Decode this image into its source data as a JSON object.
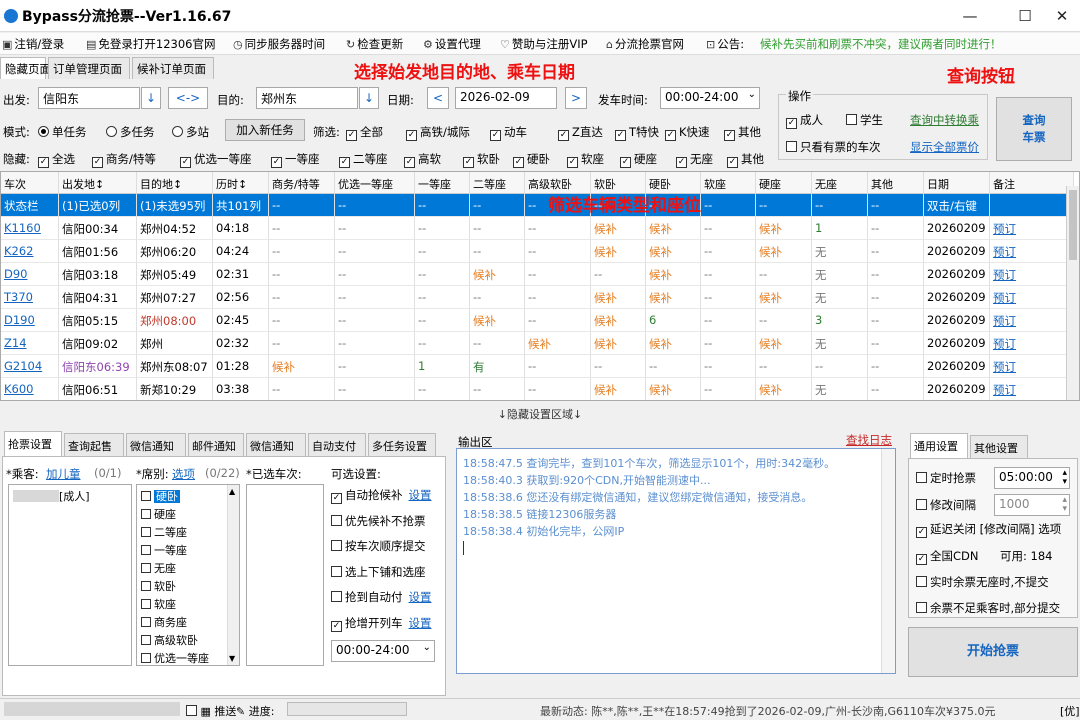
{
  "window": {
    "title": "Bypass分流抢票--Ver1.16.67",
    "min": "—",
    "max": "☐",
    "close": "✕"
  },
  "menu": [
    {
      "icon": "▣",
      "label": "注销/登录"
    },
    {
      "icon": "▤",
      "label": "免登录打开12306官网"
    },
    {
      "icon": "◷",
      "label": "同步服务器时间"
    },
    {
      "icon": "↻",
      "label": "检查更新"
    },
    {
      "icon": "⚙",
      "label": "设置代理"
    },
    {
      "icon": "♡",
      "label": "赞助与注册VIP"
    },
    {
      "icon": "⌂",
      "label": "分流抢票官网"
    },
    {
      "icon": "⊡",
      "label": "公告:"
    }
  ],
  "notice": "候补先买前和刷票不冲突，建议两者同时进行！",
  "tabs": [
    "隐藏页面",
    "订单管理页面",
    "候补订单页面"
  ],
  "annotations": {
    "top": "选择始发地目的地、乘车日期",
    "query": "查询按钮",
    "grid": "筛选车辆类型和座位"
  },
  "search": {
    "from_label": "出发:",
    "from": "信阳东",
    "swap": "<->",
    "to_label": "目的:",
    "to": "郑州东",
    "date_label": "日期:",
    "date": "2026-02-09",
    "prev": "<",
    "next": ">",
    "time_label": "发车时间:",
    "time": "00:00-24:00"
  },
  "ops": {
    "title": "操作",
    "adult": "成人",
    "student": "学生",
    "transfer": "查询中转换乘",
    "only_ticket": "只看有票的车次",
    "all_price": "显示全部票价",
    "query": "查询\n车票"
  },
  "mode": {
    "label": "模式:",
    "single": "单任务",
    "multi": "多任务",
    "multi_station": "多站",
    "add_task": "加入新任务",
    "filter_label": "筛选:",
    "filters": [
      "全部",
      "高铁/城际",
      "动车",
      "Z直达",
      "T特快",
      "K快速",
      "其他"
    ]
  },
  "hide": {
    "label": "隐藏:",
    "items": [
      "全选",
      "商务/特等",
      "优选一等座",
      "一等座",
      "二等座",
      "高软",
      "软卧",
      "硬卧",
      "软座",
      "硬座",
      "无座",
      "其他"
    ]
  },
  "grid": {
    "headers": [
      "车次",
      "出发地↕",
      "目的地↕",
      "历时↕",
      "商务/特等",
      "优选一等座",
      "一等座",
      "二等座",
      "高级软卧",
      "软卧",
      "硬卧",
      "软座",
      "硬座",
      "无座",
      "其他",
      "日期",
      "备注"
    ],
    "rows": [
      [
        "状态栏",
        "(1)已选0列",
        "(1)未选95列",
        "共101列",
        "--",
        "--",
        "--",
        "--",
        "--",
        "--",
        "--",
        "--",
        "--",
        "--",
        "--",
        "双击/右键",
        ""
      ],
      [
        "K1160",
        "信阳00:34",
        "郑州04:52",
        "04:18",
        "--",
        "--",
        "--",
        "--",
        "--",
        "候补",
        "候补",
        "--",
        "候补",
        "1",
        "--",
        "20260209",
        "预订"
      ],
      [
        "K262",
        "信阳01:56",
        "郑州06:20",
        "04:24",
        "--",
        "--",
        "--",
        "--",
        "--",
        "候补",
        "候补",
        "--",
        "候补",
        "无",
        "--",
        "20260209",
        "预订"
      ],
      [
        "D90",
        "信阳03:18",
        "郑州05:49",
        "02:31",
        "--",
        "--",
        "--",
        "候补",
        "--",
        "--",
        "候补",
        "--",
        "--",
        "无",
        "--",
        "20260209",
        "预订"
      ],
      [
        "T370",
        "信阳04:31",
        "郑州07:27",
        "02:56",
        "--",
        "--",
        "--",
        "--",
        "--",
        "候补",
        "候补",
        "--",
        "候补",
        "无",
        "--",
        "20260209",
        "预订"
      ],
      [
        "D190",
        "信阳05:15",
        "郑州08:00",
        "02:45",
        "--",
        "--",
        "--",
        "候补",
        "--",
        "候补",
        "6",
        "--",
        "--",
        "3",
        "--",
        "20260209",
        "预订"
      ],
      [
        "Z14",
        "信阳09:02",
        "郑州",
        "02:32",
        "--",
        "--",
        "--",
        "--",
        "候补",
        "候补",
        "候补",
        "--",
        "候补",
        "无",
        "--",
        "20260209",
        "预订"
      ],
      [
        "G2104",
        "信阳东06:39",
        "郑州东08:07",
        "01:28",
        "候补",
        "--",
        "1",
        "有",
        "--",
        "--",
        "--",
        "--",
        "--",
        "--",
        "--",
        "20260209",
        "预订"
      ],
      [
        "K600",
        "信阳06:51",
        "新郑10:29",
        "03:38",
        "--",
        "--",
        "--",
        "--",
        "--",
        "候补",
        "候补",
        "--",
        "候补",
        "无",
        "--",
        "20260209",
        "预订"
      ]
    ]
  },
  "hidden_area": "↓隐藏设置区域↓",
  "bottom_tabs": [
    "抢票设置",
    "查询起售",
    "微信通知",
    "邮件通知",
    "微信通知",
    "自动支付",
    "多任务设置"
  ],
  "passenger": {
    "label": "*乘客:",
    "add": "加儿童",
    "count": "(0/1)",
    "item": "[成人]"
  },
  "seats": {
    "label": "*席别:",
    "select": "选项",
    "count": "(0/22)",
    "items": [
      "硬卧",
      "硬座",
      "二等座",
      "一等座",
      "无座",
      "软卧",
      "软座",
      "商务座",
      "高级软卧",
      "优选一等座"
    ]
  },
  "selected_trains": {
    "label": "*已选车次:"
  },
  "options": {
    "title": "可选设置:",
    "items": [
      {
        "label": "自动抢候补",
        "on": true,
        "link": "设置"
      },
      {
        "label": "优先候补不抢票",
        "on": false,
        "link": ""
      },
      {
        "label": "按车次顺序提交",
        "on": false,
        "link": ""
      },
      {
        "label": "选上下铺和选座",
        "on": false,
        "link": ""
      },
      {
        "label": "抢到自动付",
        "on": false,
        "link": "设置"
      },
      {
        "label": "抢增开列车",
        "on": true,
        "link": "设置"
      }
    ],
    "time": "00:00-24:00"
  },
  "output": {
    "title": "输出区",
    "find_log": "查找日志",
    "lines": [
      "18:58:47.5  查询完毕，查到101个车次，筛选显示101个，用时:342毫秒。",
      "18:58:40.3  获取到:920个CDN,开始智能测速中...",
      "18:58:38.6  您还没有绑定微信通知，建议您绑定微信通知，接受消息。",
      "18:58:38.5  链接12306服务器",
      "18:58:38.4  初始化完毕，公网IP"
    ]
  },
  "general": {
    "tabs": [
      "通用设置",
      "其他设置"
    ],
    "timer": "定时抢票",
    "timer_value": "05:00:00",
    "interval": "修改间隔",
    "interval_value": "1000",
    "delay": "延迟关闭 [修改间隔] 选项",
    "cdn": "全国CDN",
    "cdn_avail": "可用: 184",
    "no_seat": "实时余票无座时,不提交",
    "partial": "余票不足乘客时,部分提交",
    "start": "开始抢票"
  },
  "status": {
    "push": "推送",
    "progress": "进度:",
    "news": "最新动态: 陈**,陈**,王**在18:57:49抢到了2026-02-09,广州-长沙南,G6110车次¥375.0元",
    "tail": "[优]"
  }
}
